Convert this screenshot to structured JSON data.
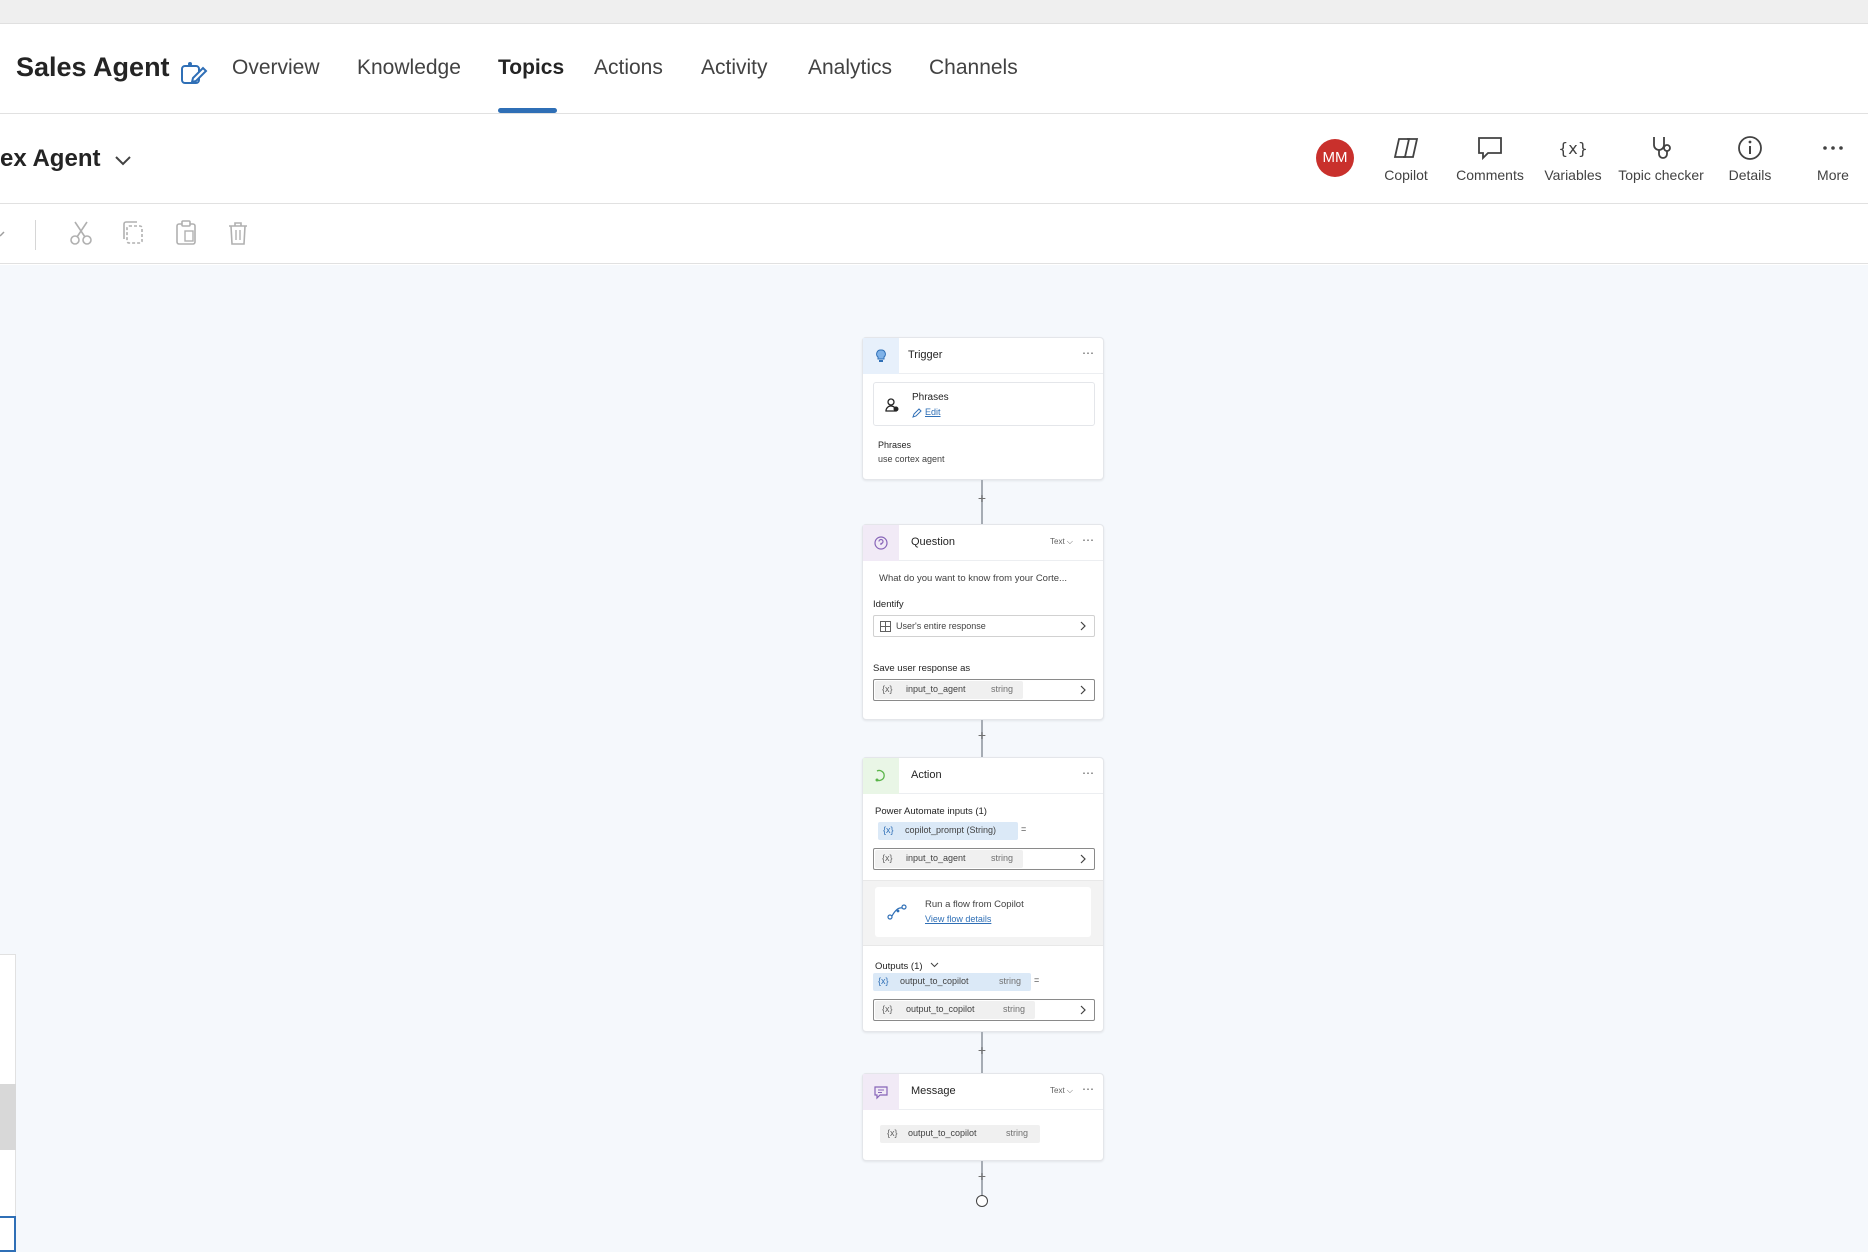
{
  "nav": {
    "agent_name": "Sales Agent",
    "tabs": [
      {
        "label": "Overview"
      },
      {
        "label": "Knowledge"
      },
      {
        "label": "Topics"
      },
      {
        "label": "Actions"
      },
      {
        "label": "Activity"
      },
      {
        "label": "Analytics"
      },
      {
        "label": "Channels"
      }
    ],
    "active_tab": "Topics"
  },
  "header": {
    "topic_name": "ex Agent",
    "avatar_initials": "MM",
    "buttons": [
      {
        "label": "Copilot",
        "icon": "copilot-icon"
      },
      {
        "label": "Comments",
        "icon": "comment-icon"
      },
      {
        "label": "Variables",
        "icon": "variables-icon"
      },
      {
        "label": "Topic checker",
        "icon": "stethoscope-icon"
      },
      {
        "label": "Details",
        "icon": "info-icon"
      },
      {
        "label": "More",
        "icon": "more-icon"
      }
    ]
  },
  "toolbar": {
    "icons": [
      "cut-icon",
      "copy-icon",
      "paste-icon",
      "delete-icon"
    ]
  },
  "flow": {
    "trigger": {
      "title": "Trigger",
      "card_title": "Phrases",
      "edit_label": "Edit",
      "phrases_label": "Phrases",
      "phrases_value": "use cortex agent"
    },
    "question": {
      "title": "Question",
      "type": "Text",
      "prompt": "What do you want to know from your Corte...",
      "identify_label": "Identify",
      "identify_value": "User's entire response",
      "save_label": "Save user response as",
      "save_var": "input_to_agent",
      "save_type": "string"
    },
    "action": {
      "title": "Action",
      "inputs_label": "Power Automate inputs (1)",
      "input_param": "copilot_prompt (String)",
      "input_var": "input_to_agent",
      "input_type": "string",
      "flow_title": "Run a flow from Copilot",
      "flow_link": "View flow details",
      "outputs_label": "Outputs (1)",
      "output_param": "output_to_copilot",
      "output_param_type": "string",
      "output_var": "output_to_copilot",
      "output_type": "string"
    },
    "message": {
      "title": "Message",
      "type": "Text",
      "var": "output_to_copilot",
      "var_type": "string"
    }
  },
  "colors": {
    "accent": "#2f6fb6",
    "avatar": "#c9302c",
    "canvas": "#f5f8fc",
    "trigger_badge": "#e7f0fb",
    "question_badge": "#f1eaf6",
    "action_badge": "#e9f6e6",
    "message_badge": "#f1eaf6"
  }
}
